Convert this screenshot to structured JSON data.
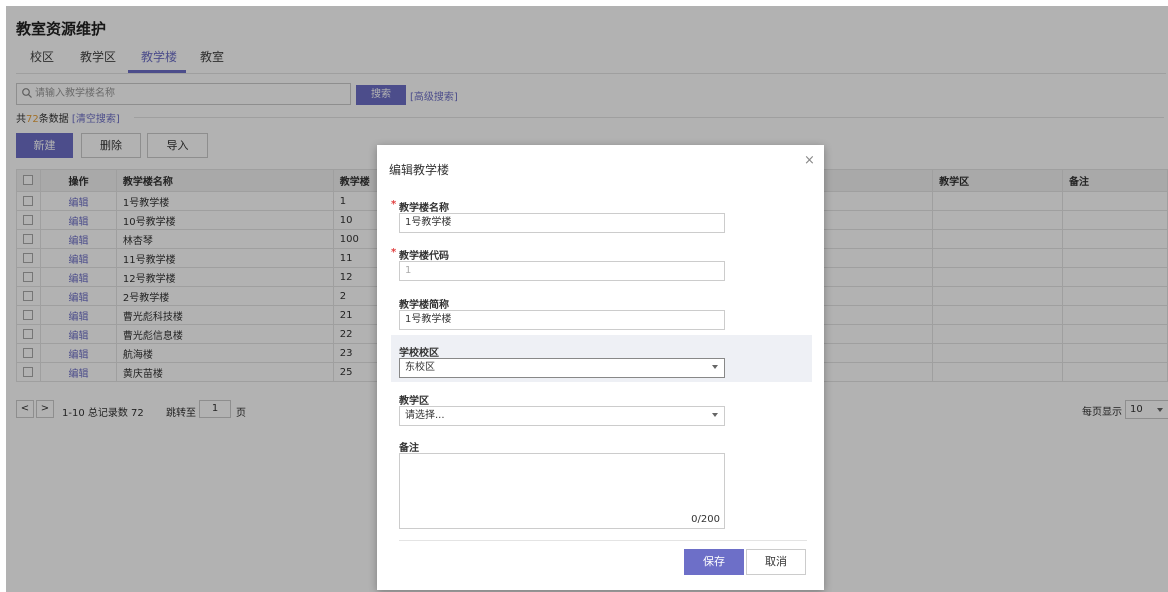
{
  "page": {
    "title": "教室资源维护"
  },
  "tabs": [
    {
      "label": "校区"
    },
    {
      "label": "教学区"
    },
    {
      "label": "教学楼"
    },
    {
      "label": "教室"
    }
  ],
  "search": {
    "placeholder": "请输入教学楼名称",
    "button": "搜索",
    "advanced": "[高级搜索]"
  },
  "summary": {
    "prefix": "共",
    "count": "72",
    "suffix": "条数据",
    "clear": "[清空搜索]"
  },
  "toolbar": {
    "new": "新建",
    "delete": "删除",
    "import": "导入"
  },
  "table": {
    "headers": [
      "操作",
      "教学楼名称",
      "教学楼",
      "教学区",
      "备注"
    ],
    "rows": [
      {
        "op": "编辑",
        "name": "1号教学楼",
        "code": "1"
      },
      {
        "op": "编辑",
        "name": "10号教学楼",
        "code": "10"
      },
      {
        "op": "编辑",
        "name": "林杏琴",
        "code": "100"
      },
      {
        "op": "编辑",
        "name": "11号教学楼",
        "code": "11"
      },
      {
        "op": "编辑",
        "name": "12号教学楼",
        "code": "12"
      },
      {
        "op": "编辑",
        "name": "2号教学楼",
        "code": "2"
      },
      {
        "op": "编辑",
        "name": "曹光彪科技楼",
        "code": "21"
      },
      {
        "op": "编辑",
        "name": "曹光彪信息楼",
        "code": "22"
      },
      {
        "op": "编辑",
        "name": "航海楼",
        "code": "23"
      },
      {
        "op": "编辑",
        "name": "黄庆苗楼",
        "code": "25"
      }
    ]
  },
  "pager": {
    "prev": "<",
    "next": ">",
    "range": "1-10 总记录数 72",
    "jump": "跳转至",
    "page": "1",
    "page_unit": "页",
    "per_page_label": "每页显示",
    "per_page": "10"
  },
  "modal": {
    "title": "编辑教学楼",
    "close": "×",
    "fields": {
      "name_label": "教学楼名称",
      "name_value": "1号教学楼",
      "code_label": "教学楼代码",
      "code_value": "1",
      "short_label": "教学楼简称",
      "short_value": "1号教学楼",
      "campus_label": "学校校区",
      "campus_value": "东校区",
      "area_label": "教学区",
      "area_value": "请选择...",
      "note_label": "备注",
      "note_count": "0/200"
    },
    "required_mark": "*",
    "save": "保存",
    "cancel": "取消"
  }
}
